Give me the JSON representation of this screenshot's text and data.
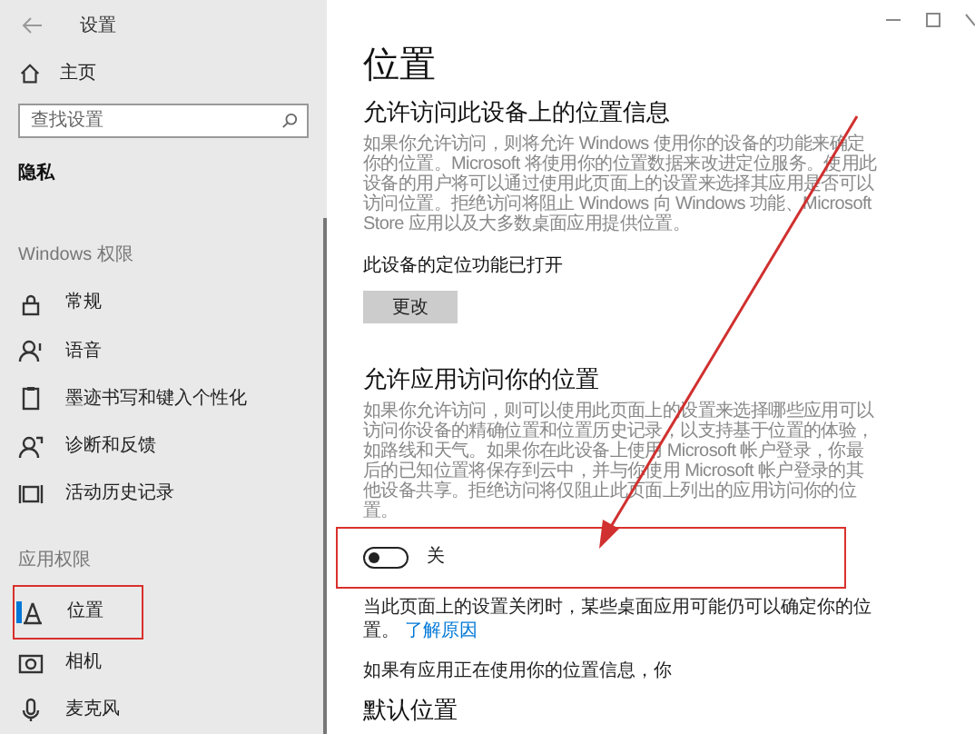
{
  "window": {
    "title": "设置"
  },
  "sidebar": {
    "home": "主页",
    "search": {
      "placeholder": "查找设置"
    },
    "category": "隐私",
    "sections": [
      {
        "heading": "Windows 权限",
        "items": [
          {
            "label": "常规",
            "kind": "lock",
            "selected": false
          },
          {
            "label": "语音",
            "kind": "voice",
            "selected": false
          },
          {
            "label": "墨迹书写和键入个性化",
            "kind": "clipboard",
            "selected": false
          },
          {
            "label": "诊断和反馈",
            "kind": "feedback",
            "selected": false
          },
          {
            "label": "活动历史记录",
            "kind": "timeline",
            "selected": false
          }
        ]
      },
      {
        "heading": "应用权限",
        "items": [
          {
            "label": "位置",
            "kind": "location",
            "selected": true
          },
          {
            "label": "相机",
            "kind": "camera",
            "selected": false
          },
          {
            "label": "麦克风",
            "kind": "mic",
            "selected": false
          }
        ]
      }
    ]
  },
  "page": {
    "title": "位置",
    "device_section": {
      "heading": "允许访问此设备上的位置信息",
      "description": "如果你允许访问，则将允许 Windows 使用你的设备的功能来确定你的位置。Microsoft 将使用你的位置数据来改进定位服务。使用此设备的用户将可以通过使用此页面上的设置来选择其应用是否可以访问位置。拒绝访问将阻止 Windows 向 Windows 功能、Microsoft Store 应用以及大多数桌面应用提供位置。",
      "status": "此设备的定位功能已打开",
      "button": "更改"
    },
    "apps_section": {
      "heading": "允许应用访问你的位置",
      "description": "如果你允许访问，则可以使用此页面上的设置来选择哪些应用可以访问你设备的精确位置和位置历史记录，以支持基于位置的体验，如路线和天气。如果你在此设备上使用 Microsoft 帐户登录，你最后的已知位置将保存到云中，并与你使用 Microsoft 帐户登录的其他设备共享。拒绝访问将仅阻止此页面上列出的应用访问你的位置。",
      "toggle": {
        "on": false,
        "label": "关"
      },
      "note": "当此页面上的设置关闭时，某些桌面应用可能仍可以确定你的位置。",
      "link": "了解原因",
      "in_use": "如果有应用正在使用你的位置信息，你"
    },
    "next_heading": "默认位置"
  }
}
